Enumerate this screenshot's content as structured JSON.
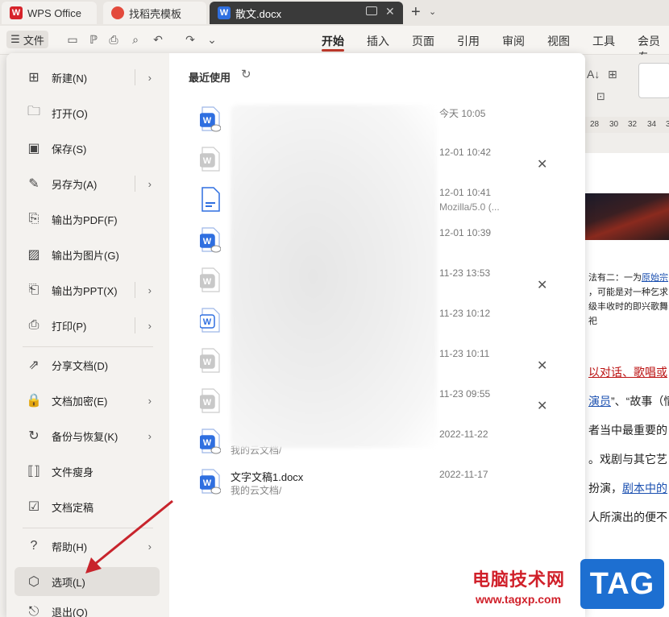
{
  "tabs": [
    {
      "label": "WPS Office",
      "icon": "wps-logo-icon"
    },
    {
      "label": "找稻壳模板",
      "icon": "docer-icon"
    },
    {
      "label": "散文.docx",
      "icon": "word-doc-icon",
      "active": true
    }
  ],
  "toolbar": {
    "file_label": "文件",
    "ribbon_tabs": [
      "开始",
      "插入",
      "页面",
      "引用",
      "审阅",
      "视图",
      "工具",
      "会员专"
    ]
  },
  "menu": {
    "items": [
      {
        "label": "新建(N)",
        "icon": "new-doc-icon",
        "arrow": true
      },
      {
        "label": "打开(O)",
        "icon": "folder-open-icon",
        "arrow": false
      },
      {
        "label": "保存(S)",
        "icon": "save-icon",
        "arrow": false
      },
      {
        "label": "另存为(A)",
        "icon": "save-as-icon",
        "arrow": true
      },
      {
        "label": "输出为PDF(F)",
        "icon": "export-pdf-icon",
        "arrow": false
      },
      {
        "label": "输出为图片(G)",
        "icon": "export-image-icon",
        "arrow": false
      },
      {
        "label": "输出为PPT(X)",
        "icon": "export-ppt-icon",
        "arrow": true
      },
      {
        "label": "打印(P)",
        "icon": "printer-icon",
        "arrow": true
      },
      {
        "label": "分享文档(D)",
        "icon": "share-icon",
        "arrow": false
      },
      {
        "label": "文档加密(E)",
        "icon": "lock-icon",
        "arrow": true
      },
      {
        "label": "备份与恢复(K)",
        "icon": "backup-icon",
        "arrow": true
      },
      {
        "label": "文件瘦身",
        "icon": "compress-icon",
        "arrow": false
      },
      {
        "label": "文档定稿",
        "icon": "finalize-icon",
        "arrow": false
      },
      {
        "label": "帮助(H)",
        "icon": "help-icon",
        "arrow": true
      },
      {
        "label": "选项(L)",
        "icon": "settings-icon",
        "arrow": false,
        "active": true
      },
      {
        "label": "退出(Q)",
        "icon": "exit-icon",
        "arrow": false
      }
    ]
  },
  "recent": {
    "title": "最近使用",
    "files": [
      {
        "time": "今天  10:05",
        "sub": "",
        "icon": "word-cloud",
        "closable": false,
        "name": "",
        "path": ""
      },
      {
        "time": "12-01  10:42",
        "sub": "",
        "icon": "word-gray",
        "closable": true,
        "name": "",
        "path": ""
      },
      {
        "time": "12-01  10:41",
        "sub": "Mozilla/5.0 (...",
        "icon": "text-doc",
        "closable": false,
        "name": "",
        "path": ""
      },
      {
        "time": "12-01  10:39",
        "sub": "",
        "icon": "word-cloud",
        "closable": false,
        "name": "",
        "path": ""
      },
      {
        "time": "11-23  13:53",
        "sub": "",
        "icon": "word-gray",
        "closable": true,
        "name": "",
        "path": ""
      },
      {
        "time": "11-23  10:12",
        "sub": "",
        "icon": "word-blue-outline",
        "closable": false,
        "name": "",
        "path": ""
      },
      {
        "time": "11-23  10:11",
        "sub": "",
        "icon": "word-gray",
        "closable": true,
        "name": "",
        "path": ""
      },
      {
        "time": "11-23  09:55",
        "sub": "",
        "icon": "word-gray",
        "closable": true,
        "name": "",
        "path": ""
      },
      {
        "time": "2022-11-22",
        "sub": "",
        "icon": "word-cloud",
        "closable": false,
        "name": "",
        "path": "我的云文档/"
      },
      {
        "time": "2022-11-17",
        "sub": "",
        "icon": "word-cloud",
        "closable": false,
        "name": "文字文稿1.docx",
        "path": "我的云文档/"
      }
    ]
  },
  "document": {
    "ruler": [
      "28",
      "30",
      "32",
      "34",
      "3"
    ],
    "lines": [
      {
        "text": "法有二：一为",
        "link": "原始宗",
        "small": true
      },
      {
        "text": "，可能是对一种乞求",
        "link": "",
        "small": true
      },
      {
        "text": "级丰收时的即兴歌舞",
        "link": "",
        "small": true
      },
      {
        "text": "祀",
        "link": "",
        "small": true
      },
      {
        "text": "以对话、歌唱或",
        "link": "",
        "small": false
      },
      {
        "text": "演员",
        "link": "”、“故事（情",
        "small": false
      },
      {
        "text": "者当中最重要的",
        "link": "",
        "small": false
      },
      {
        "text": "。戏剧与其它艺",
        "link": "",
        "small": false
      },
      {
        "text": "扮演，",
        "link": "剧本中的",
        "small": false
      },
      {
        "text": "人所演出的便不",
        "link": "",
        "small": false
      }
    ]
  },
  "watermark": {
    "text": "电脑技术网",
    "url": "www.tagxp.com",
    "logo": "TAG"
  },
  "colors": {
    "accent": "#c0392b",
    "word_blue": "#2f6fe0",
    "arrow": "#c8242c"
  }
}
